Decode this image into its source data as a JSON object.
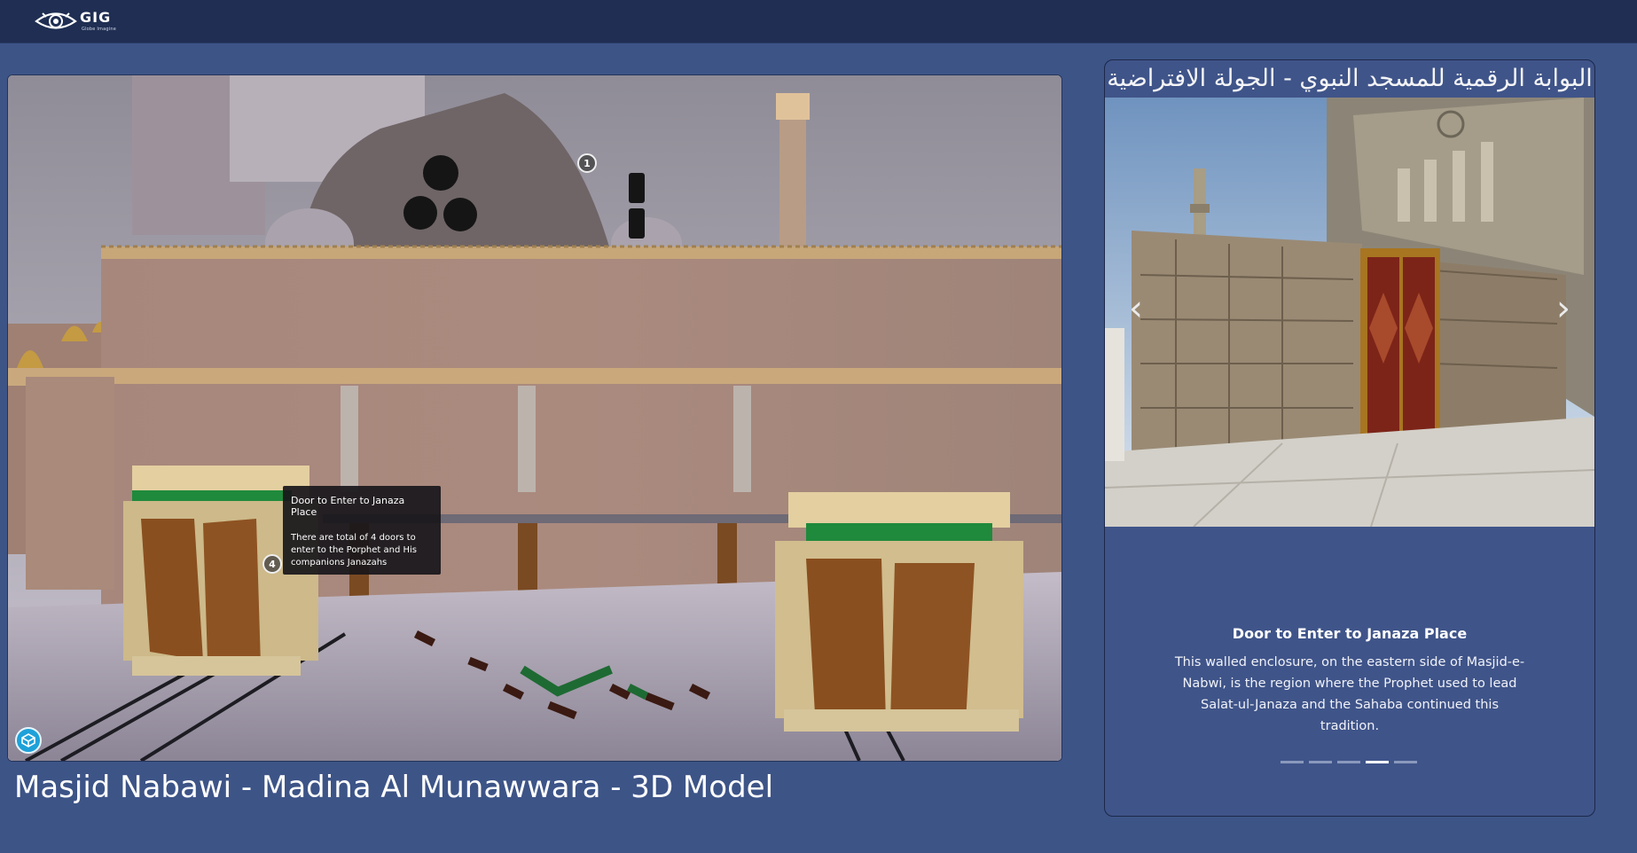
{
  "header": {
    "logo_text": "GIG",
    "logo_subtext": "Globe Imagine"
  },
  "viewer": {
    "hotspots": [
      {
        "number": "1"
      },
      {
        "number": "4"
      }
    ],
    "tooltip": {
      "title": "Door to Enter to Janaza Place",
      "body": "There are total of 4 doors to enter to the Porphet and His companions Janazahs"
    }
  },
  "page": {
    "title": "Masjid Nabawi - Madina Al Munawwara - 3D Model"
  },
  "panel": {
    "title": "البوابة الرقمية للمسجد النبوي - الجولة الافتراضية",
    "prev_icon": "chevron-left-icon",
    "next_icon": "chevron-right-icon",
    "caption_title": "Door to Enter to Janaza Place",
    "caption_body": "This walled enclosure, on the eastern side of Masjid-e-Nabwi, is the region where the Prophet used to lead Salat-ul-Janaza and the Sahaba continued this tradition.",
    "slides_total": 5,
    "active_slide": 4
  },
  "colors": {
    "page_background": "#3d5487",
    "topbar": "#1f2e52",
    "accent_green": "#1e8a3a"
  }
}
